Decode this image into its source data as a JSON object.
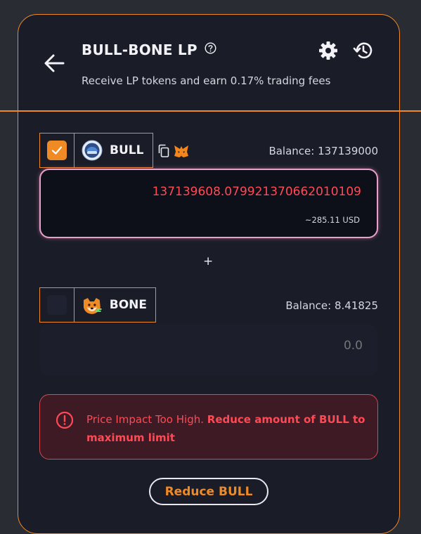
{
  "header": {
    "title": "BULL-BONE LP",
    "subtitle": "Receive LP tokens and earn 0.17% trading fees",
    "back_icon": "arrow-left-icon",
    "help_icon": "question-circle-icon",
    "settings_icon": "gear-icon",
    "history_icon": "history-icon"
  },
  "token_a": {
    "checked": true,
    "name": "BULL",
    "balance": "Balance: 137139000",
    "amount": "137139608.079921370662010109",
    "usd": "~285.11 USD",
    "logo_icon": "bull-token-icon",
    "copy_icon": "copy-icon",
    "wallet_icon": "metamask-icon"
  },
  "plus_sign": "+",
  "token_b": {
    "checked": false,
    "name": "BONE",
    "balance": "Balance: 8.41825",
    "amount_placeholder": "0.0",
    "logo_icon": "bone-token-icon"
  },
  "warning": {
    "icon": "exclamation-circle-icon",
    "text_normal": "Price Impact Too High. ",
    "text_bold": "Reduce amount of BULL to maximum limit"
  },
  "reduce_button": {
    "label": "Reduce BULL"
  },
  "colors": {
    "accent": "#f08a24",
    "error": "#ff4a55",
    "card_bg": "#1a1d27",
    "page_bg": "#2a2c33"
  }
}
